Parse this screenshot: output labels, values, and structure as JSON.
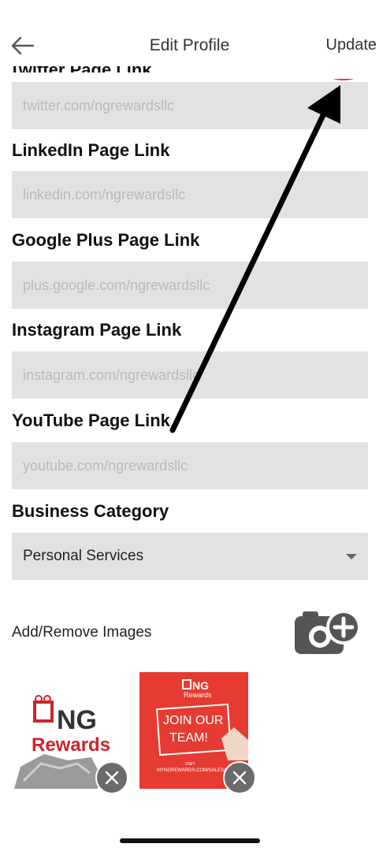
{
  "header": {
    "title": "Edit Profile",
    "update_label": "Update",
    "partial_label": "Twitter Page Link"
  },
  "form": {
    "fields": [
      {
        "label": "",
        "value": "twitter.com/ngrewardsllc"
      },
      {
        "label": "LinkedIn Page Link",
        "value": "linkedin.com/ngrewardsllc"
      },
      {
        "label": "Google Plus Page Link",
        "value": "plus.google.com/ngrewardsllc"
      },
      {
        "label": "Instagram Page Link",
        "value": "instagram.com/ngrewardsllc"
      },
      {
        "label": "YouTube Page Link",
        "value": "youtube.com/ngrewardsllc"
      }
    ],
    "category": {
      "label": "Business Category",
      "selected": "Personal Services"
    }
  },
  "images": {
    "label": "Add/Remove Images",
    "thumb1": {
      "brand_text": "NG",
      "sub_text": "Rewards"
    },
    "thumb2": {
      "brand_text": "NG",
      "sub_text": "Rewards",
      "headline_1": "JOIN OUR",
      "headline_2": "TEAM!",
      "visit": "VISIT",
      "url": "MYNGREWARDS.COM/SALESAGENT"
    }
  },
  "colors": {
    "field_bg": "#e2e2e2",
    "annotation_red": "#e8373f",
    "thumb_red": "#e53b32"
  },
  "icons": [
    "back-arrow-icon",
    "add-photo-icon",
    "remove-image-icon",
    "dropdown-caret-icon"
  ]
}
